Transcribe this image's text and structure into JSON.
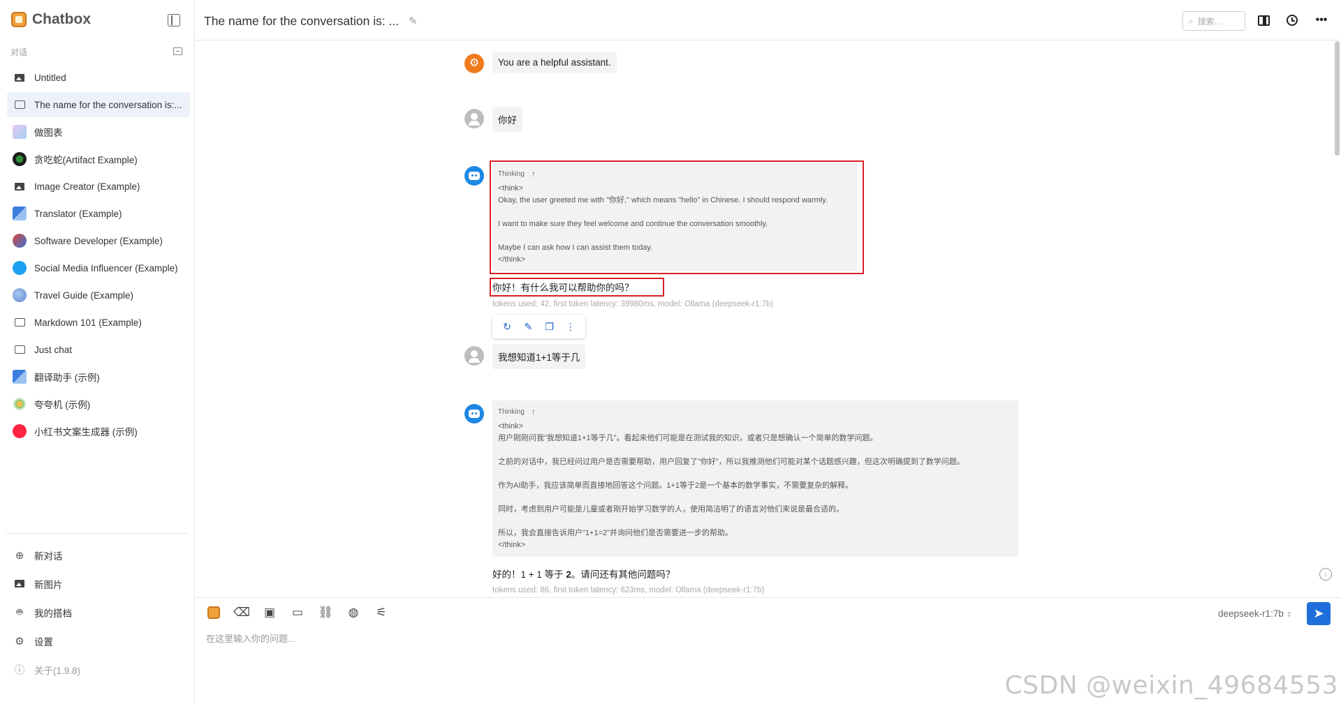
{
  "app": {
    "name": "Chatbox",
    "version_label": "关于(1.9.8)"
  },
  "sidebar": {
    "section_label": "对话",
    "conversations": [
      {
        "label": "Untitled",
        "icon": "image-icon"
      },
      {
        "label": "The name for the conversation is:...",
        "icon": "chat-bubble-icon",
        "active": true
      },
      {
        "label": "做图表",
        "icon": "chart-avatar-icon"
      },
      {
        "label": "贪吃蛇(Artifact Example)",
        "icon": "snake-avatar-icon"
      },
      {
        "label": "Image Creator (Example)",
        "icon": "image-icon"
      },
      {
        "label": "Translator (Example)",
        "icon": "translator-avatar-icon"
      },
      {
        "label": "Software Developer (Example)",
        "icon": "developer-avatar-icon"
      },
      {
        "label": "Social Media Influencer (Example)",
        "icon": "twitter-avatar-icon"
      },
      {
        "label": "Travel Guide (Example)",
        "icon": "globe-avatar-icon"
      },
      {
        "label": "Markdown 101 (Example)",
        "icon": "chat-bubble-icon"
      },
      {
        "label": "Just chat",
        "icon": "chat-bubble-icon"
      },
      {
        "label": "翻译助手 (示例)",
        "icon": "translator-avatar-icon"
      },
      {
        "label": "夸夸机 (示例)",
        "icon": "flower-avatar-icon"
      },
      {
        "label": "小红书文案生成器 (示例)",
        "icon": "xiaohongshu-avatar-icon"
      }
    ],
    "menu": [
      {
        "label": "新对话",
        "icon": "plus-circle-icon"
      },
      {
        "label": "新图片",
        "icon": "image-icon"
      },
      {
        "label": "我的搭档",
        "icon": "robot-icon"
      },
      {
        "label": "设置",
        "icon": "gear-icon"
      }
    ]
  },
  "header": {
    "title": "The name for the conversation is: ...",
    "search_placeholder": "搜索..."
  },
  "messages": {
    "system": "You are a helpful assistant.",
    "user1": "你好",
    "think1": {
      "label": "Thinking",
      "lines": [
        "<think>",
        "Okay, the user greeted me with \"你好,\" which means \"hello\" in Chinese. I should respond warmly.",
        "",
        "I want to make sure they feel welcome and continue the conversation smoothly.",
        "",
        "Maybe I can ask how I can assist them today.",
        "</think>"
      ]
    },
    "answer1": "你好！有什么我可以帮助你的吗？",
    "meta1": "tokens used: 42, first token latency: 39980ms, model: Ollama (deepseek-r1:7b)",
    "user2": "我想知道1+1等于几",
    "think2": {
      "label": "Thinking",
      "lines": [
        "<think>",
        "用户刚刚问我\"我想知道1+1等于几\"。看起来他们可能是在测试我的知识，或者只是想确认一个简单的数学问题。",
        "",
        "之前的对话中，我已经问过用户是否需要帮助，用户回复了\"你好\"，所以我推测他们可能对某个话题感兴趣，但这次明确提到了数学问题。",
        "",
        "作为AI助手，我应该简单而直接地回答这个问题。1+1等于2是一个基本的数学事实，不需要复杂的解释。",
        "",
        "同时，考虑到用户可能是儿童或者刚开始学习数学的人，使用简洁明了的语言对他们来说是最合适的。",
        "",
        "所以，我会直接告诉用户\"1+1=2\"并询问他们是否需要进一步的帮助。",
        "</think>"
      ]
    },
    "answer2": {
      "before": "好的！1 + 1 等于 ",
      "bold": "2",
      "after": "。请问还有其他问题吗？"
    },
    "meta2": "tokens used: 86, first token latency: 623ms, model: Ollama (deepseek-r1:7b)"
  },
  "composer": {
    "placeholder": "在这里输入你的问题...",
    "model": "deepseek-r1:7b"
  },
  "watermark": "CSDN @weixin_49684553",
  "colors": {
    "accent": "#1e6fd9",
    "highlight_box": "#d91f26",
    "active_item": "#edf2fa"
  }
}
